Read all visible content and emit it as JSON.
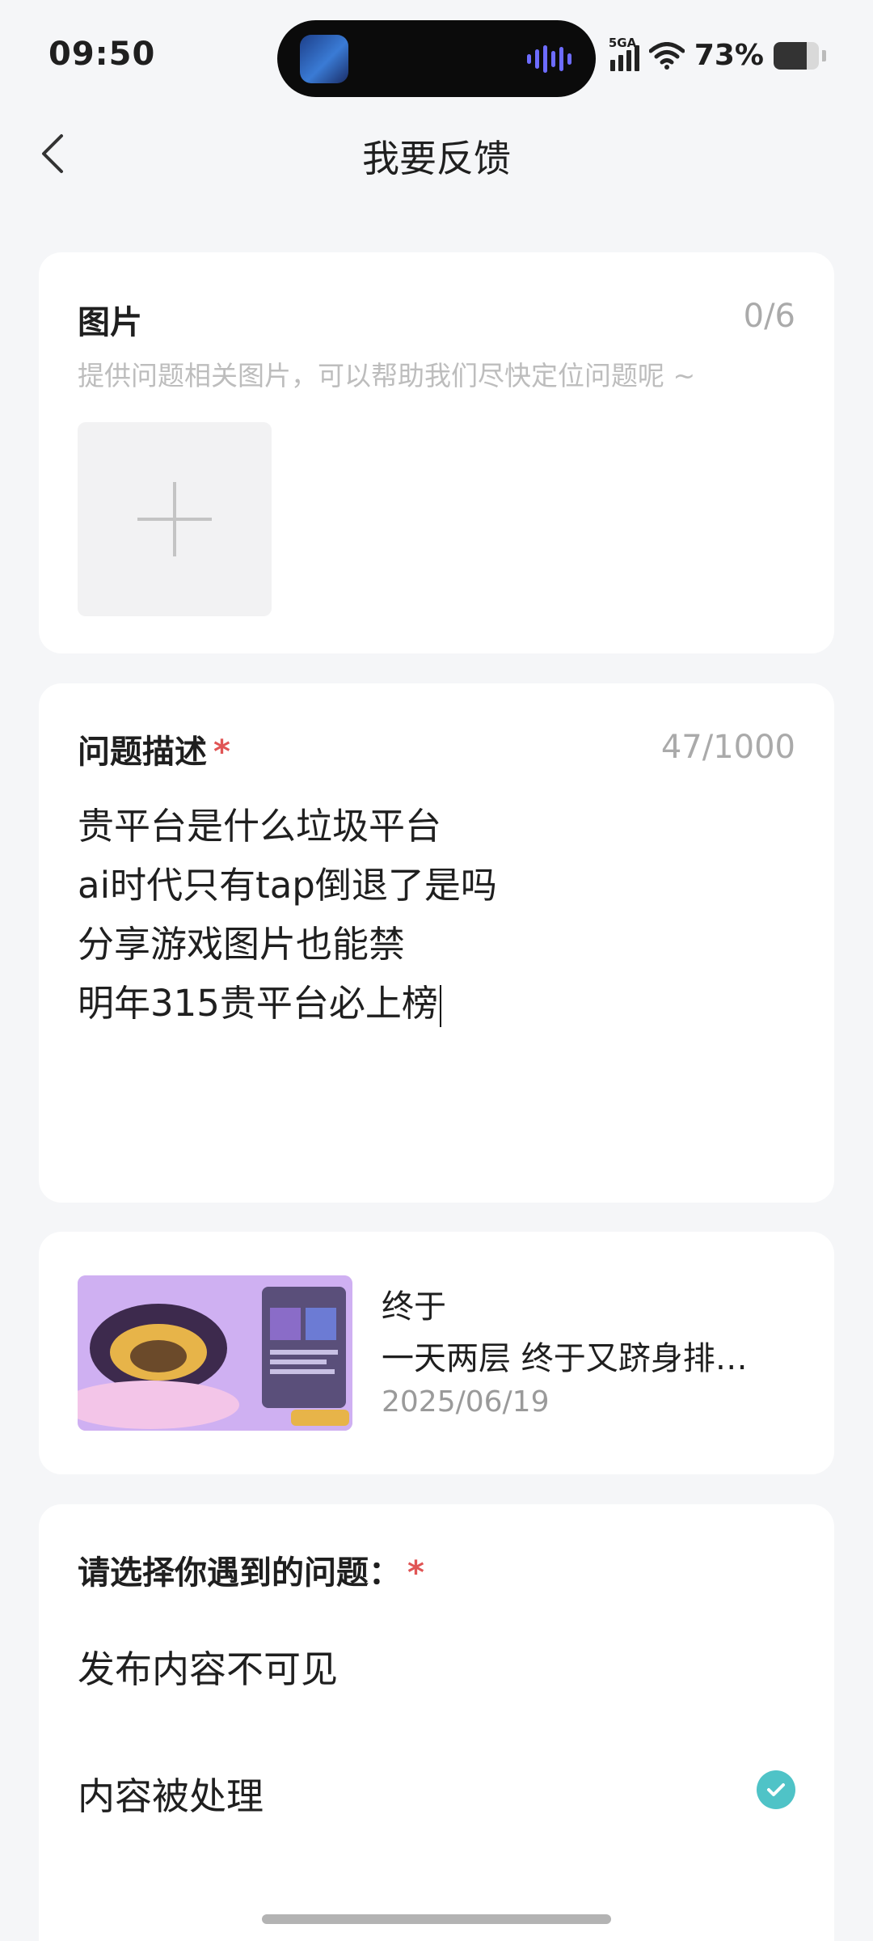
{
  "status_bar": {
    "time": "09:50",
    "network": "5GA",
    "battery_percent": "73%",
    "battery_level": 0.73
  },
  "nav": {
    "title": "我要反馈",
    "back_icon": "chevron-left-icon"
  },
  "images_section": {
    "title": "图片",
    "counter": "0/6",
    "hint": "提供问题相关图片，可以帮助我们尽快定位问题呢 ~",
    "add_icon": "plus-icon"
  },
  "description_section": {
    "title": "问题描述",
    "required_mark": "*",
    "counter": "47/1000",
    "lines": [
      "贵平台是什么垃圾平台",
      "ai时代只有tap倒退了是吗",
      "分享游戏图片也能禁",
      "明年315贵平台必上榜"
    ]
  },
  "post": {
    "title": "终于",
    "subtitle": "一天两层 终于又跻身排行榜了",
    "date": "2025/06/19"
  },
  "problem_section": {
    "title": "请选择你遇到的问题：",
    "required_mark": "*",
    "options": [
      {
        "label": "发布内容不可见",
        "selected": false
      },
      {
        "label": "内容被处理",
        "selected": true
      }
    ]
  },
  "colors": {
    "accent_check": "#4fc3c7",
    "required": "#e05555",
    "background": "#f5f6f8"
  }
}
